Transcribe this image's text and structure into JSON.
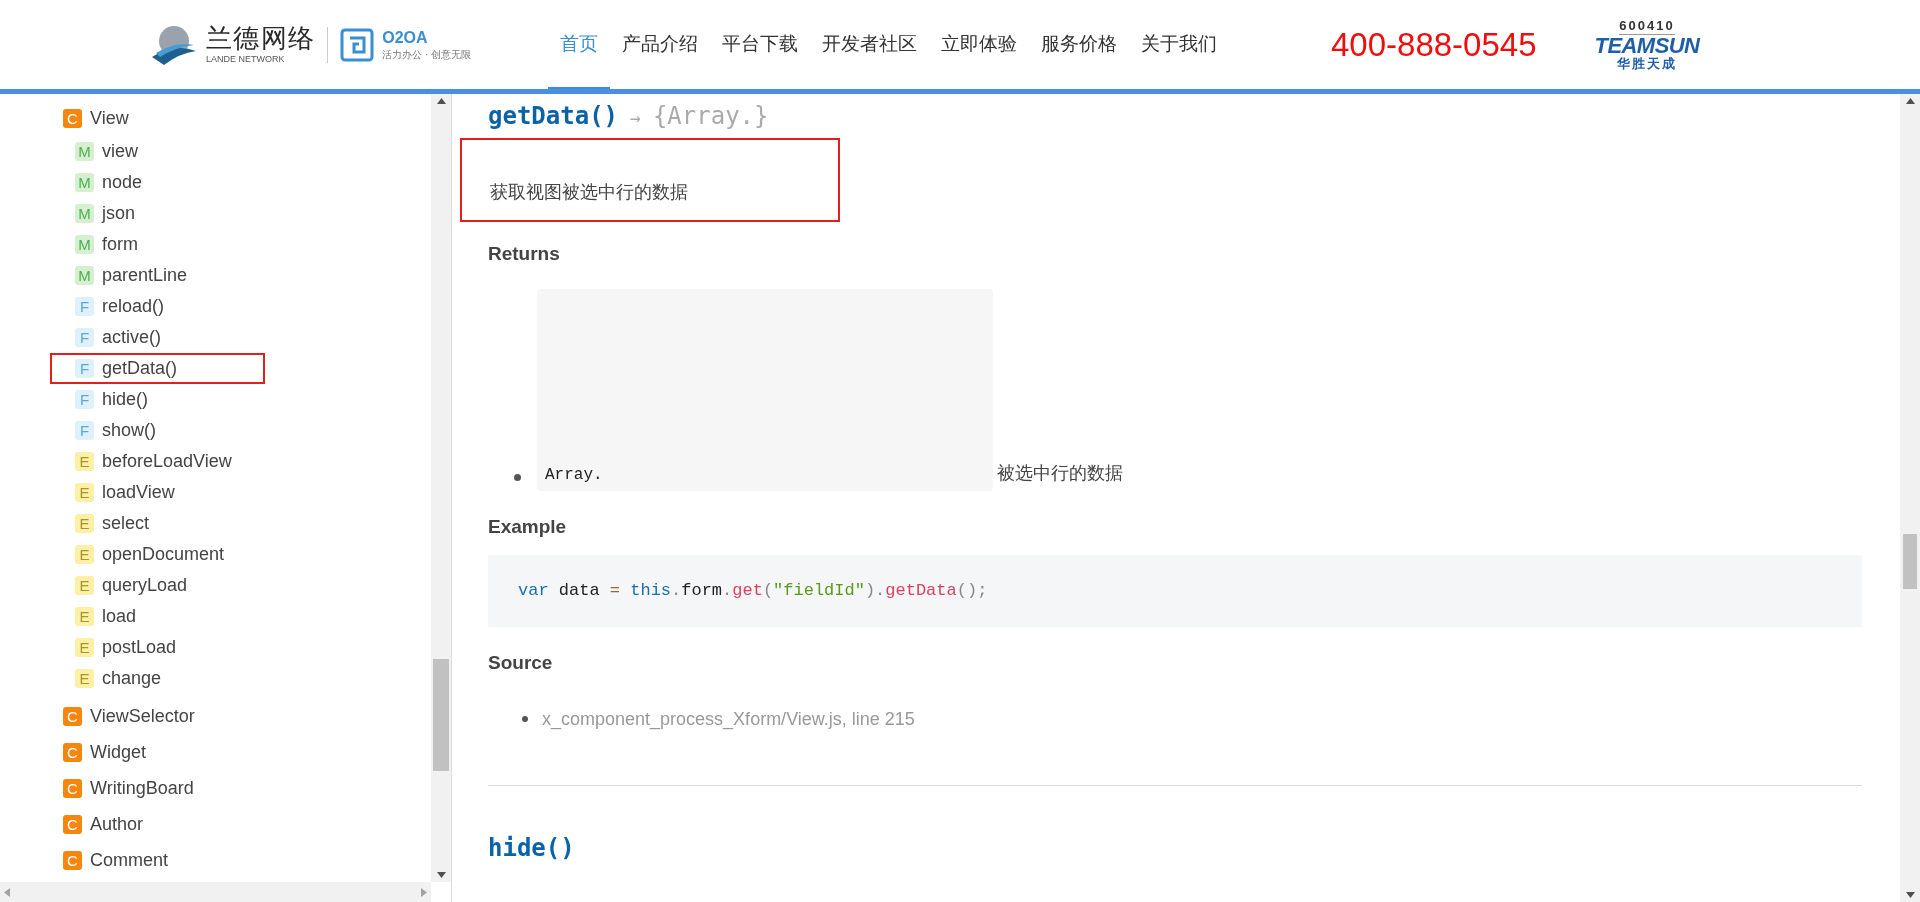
{
  "header": {
    "logo": {
      "name": "兰德网络",
      "sub": "LANDE NETWORK",
      "product": "O2OA",
      "slogan": "活力办公 · 创意无限"
    },
    "nav": [
      {
        "label": "首页",
        "selected": true
      },
      {
        "label": "产品介绍",
        "selected": false
      },
      {
        "label": "平台下载",
        "selected": false
      },
      {
        "label": "开发者社区",
        "selected": false
      },
      {
        "label": "立即体验",
        "selected": false
      },
      {
        "label": "服务价格",
        "selected": false
      },
      {
        "label": "关于我们",
        "selected": false
      }
    ],
    "phone": "400-888-0545",
    "partner_logo": {
      "code": "600410",
      "name": "TEAMSUN",
      "sub": "华胜天成"
    }
  },
  "sidebar": {
    "tree": [
      {
        "kind": "class",
        "badge": "C",
        "label": "View",
        "selected": false,
        "children": [
          {
            "kind": "member",
            "badge": "M",
            "label": "view",
            "selected": false
          },
          {
            "kind": "member",
            "badge": "M",
            "label": "node",
            "selected": false
          },
          {
            "kind": "member",
            "badge": "M",
            "label": "json",
            "selected": false
          },
          {
            "kind": "member",
            "badge": "M",
            "label": "form",
            "selected": false
          },
          {
            "kind": "member",
            "badge": "M",
            "label": "parentLine",
            "selected": false
          },
          {
            "kind": "function",
            "badge": "F",
            "label": "reload()",
            "selected": false
          },
          {
            "kind": "function",
            "badge": "F",
            "label": "active()",
            "selected": false
          },
          {
            "kind": "function",
            "badge": "F",
            "label": "getData()",
            "selected": true
          },
          {
            "kind": "function",
            "badge": "F",
            "label": "hide()",
            "selected": false
          },
          {
            "kind": "function",
            "badge": "F",
            "label": "show()",
            "selected": false
          },
          {
            "kind": "event",
            "badge": "E",
            "label": "beforeLoadView",
            "selected": false
          },
          {
            "kind": "event",
            "badge": "E",
            "label": "loadView",
            "selected": false
          },
          {
            "kind": "event",
            "badge": "E",
            "label": "select",
            "selected": false
          },
          {
            "kind": "event",
            "badge": "E",
            "label": "openDocument",
            "selected": false
          },
          {
            "kind": "event",
            "badge": "E",
            "label": "queryLoad",
            "selected": false
          },
          {
            "kind": "event",
            "badge": "E",
            "label": "load",
            "selected": false
          },
          {
            "kind": "event",
            "badge": "E",
            "label": "postLoad",
            "selected": false
          },
          {
            "kind": "event",
            "badge": "E",
            "label": "change",
            "selected": false
          }
        ]
      },
      {
        "kind": "class",
        "badge": "C",
        "label": "ViewSelector",
        "selected": false
      },
      {
        "kind": "class",
        "badge": "C",
        "label": "Widget",
        "selected": false
      },
      {
        "kind": "class",
        "badge": "C",
        "label": "WritingBoard",
        "selected": false
      },
      {
        "kind": "class",
        "badge": "C",
        "label": "Author",
        "selected": false
      },
      {
        "kind": "class",
        "badge": "C",
        "label": "Comment",
        "selected": false
      }
    ]
  },
  "main": {
    "title": {
      "name": "getData()",
      "arrow": "→",
      "returns": "{Array.}"
    },
    "description": {
      "text": "获取视图被选中行的数据",
      "highlighted": true
    },
    "returns": {
      "heading": "Returns",
      "type": "Array.",
      "text": "被选中行的数据"
    },
    "example": {
      "heading": "Example",
      "code": [
        {
          "kind": "keyword",
          "text": "var"
        },
        {
          "kind": "plain",
          "text": " data "
        },
        {
          "kind": "operator",
          "text": "="
        },
        {
          "kind": "keyword",
          "text": " this"
        },
        {
          "kind": "punct",
          "text": "."
        },
        {
          "kind": "plain",
          "text": "form"
        },
        {
          "kind": "punct",
          "text": "."
        },
        {
          "kind": "function",
          "text": "get"
        },
        {
          "kind": "punct",
          "text": "("
        },
        {
          "kind": "string",
          "text": "\"fieldId\""
        },
        {
          "kind": "punct",
          "text": ")."
        },
        {
          "kind": "function",
          "text": "getData"
        },
        {
          "kind": "punct",
          "text": "();"
        }
      ]
    },
    "source": {
      "heading": "Source",
      "items": [
        "x_component_process_Xform/View.js, line 215"
      ]
    },
    "next_title": "hide()"
  }
}
